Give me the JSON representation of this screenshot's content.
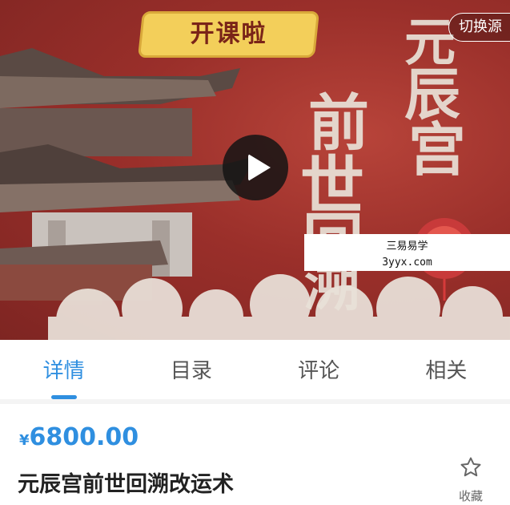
{
  "video": {
    "banner_text": "开课啦",
    "cover_title_chars": [
      "元",
      "辰",
      "宫",
      "前",
      "世",
      "回",
      "溯"
    ],
    "switch_source_label": "切换源",
    "watermark_line1": "三易易学",
    "watermark_line2": "3yyx.com"
  },
  "tabs": [
    {
      "label": "详情",
      "active": true
    },
    {
      "label": "目录",
      "active": false
    },
    {
      "label": "评论",
      "active": false
    },
    {
      "label": "相关",
      "active": false
    }
  ],
  "product": {
    "currency_symbol": "¥",
    "price": "6800.00",
    "title": "元辰宫前世回溯改运术",
    "favorite_label": "收藏"
  },
  "colors": {
    "accent": "#2f8fe0",
    "cover_red": "#9a2f2a"
  }
}
